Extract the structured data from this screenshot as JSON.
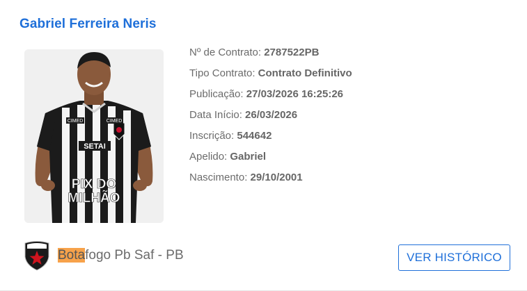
{
  "player": {
    "name": "Gabriel Ferreira Neris"
  },
  "details": [
    {
      "label": "Nº de Contrato: ",
      "value": "2787522PB"
    },
    {
      "label": "Tipo Contrato: ",
      "value": "Contrato Definitivo"
    },
    {
      "label": "Publicação: ",
      "value": "27/03/2026 16:25:26"
    },
    {
      "label": "Data Início: ",
      "value": "26/03/2026"
    },
    {
      "label": "Inscrição: ",
      "value": "544642"
    },
    {
      "label": "Apelido: ",
      "value": "Gabriel"
    },
    {
      "label": "Nascimento: ",
      "value": "29/10/2001"
    }
  ],
  "photo": {
    "shirt_sponsor_top": "CIMED",
    "shirt_sponsor_mid": "SETAI",
    "shirt_sponsor_main_1": "PIX DO",
    "shirt_sponsor_main_2": "MILHÃO"
  },
  "club": {
    "name_highlight": "Bota",
    "name_rest": "fogo Pb Saf - PB",
    "icon": "botafogo-pb-crest-icon"
  },
  "actions": {
    "history_label": "VER HISTÓRICO"
  },
  "colors": {
    "accent": "#1e6fd9",
    "highlight": "#f7a24a",
    "text": "#6b6b6b"
  }
}
